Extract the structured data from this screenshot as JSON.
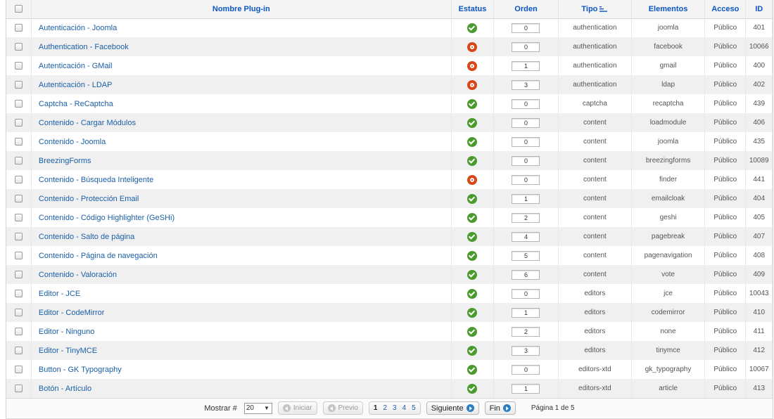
{
  "headers": {
    "name": "Nombre Plug-in",
    "status": "Estatus",
    "order": "Orden",
    "type": "Tipo",
    "elements": "Elementos",
    "access": "Acceso",
    "id": "ID"
  },
  "rows": [
    {
      "name": "Autenticación - Joomla",
      "status": "enabled",
      "order": "0",
      "type": "authentication",
      "element": "joomla",
      "access": "Público",
      "id": "401"
    },
    {
      "name": "Authentication - Facebook",
      "status": "disabled",
      "order": "0",
      "type": "authentication",
      "element": "facebook",
      "access": "Público",
      "id": "10066"
    },
    {
      "name": "Autenticación - GMail",
      "status": "disabled",
      "order": "1",
      "type": "authentication",
      "element": "gmail",
      "access": "Público",
      "id": "400"
    },
    {
      "name": "Autenticación - LDAP",
      "status": "disabled",
      "order": "3",
      "type": "authentication",
      "element": "ldap",
      "access": "Público",
      "id": "402"
    },
    {
      "name": "Captcha - ReCaptcha",
      "status": "enabled",
      "order": "0",
      "type": "captcha",
      "element": "recaptcha",
      "access": "Público",
      "id": "439"
    },
    {
      "name": "Contenido - Cargar Módulos",
      "status": "enabled",
      "order": "0",
      "type": "content",
      "element": "loadmodule",
      "access": "Público",
      "id": "406"
    },
    {
      "name": "Contenido - Joomla",
      "status": "enabled",
      "order": "0",
      "type": "content",
      "element": "joomla",
      "access": "Público",
      "id": "435"
    },
    {
      "name": "BreezingForms",
      "status": "enabled",
      "order": "0",
      "type": "content",
      "element": "breezingforms",
      "access": "Público",
      "id": "10089"
    },
    {
      "name": "Contenido - Búsqueda Inteligente",
      "status": "disabled",
      "order": "0",
      "type": "content",
      "element": "finder",
      "access": "Público",
      "id": "441"
    },
    {
      "name": "Contenido - Protección Email",
      "status": "enabled",
      "order": "1",
      "type": "content",
      "element": "emailcloak",
      "access": "Público",
      "id": "404"
    },
    {
      "name": "Contenido - Código Highlighter (GeSHi)",
      "status": "enabled",
      "order": "2",
      "type": "content",
      "element": "geshi",
      "access": "Público",
      "id": "405"
    },
    {
      "name": "Contenido - Salto de página",
      "status": "enabled",
      "order": "4",
      "type": "content",
      "element": "pagebreak",
      "access": "Público",
      "id": "407"
    },
    {
      "name": "Contenido - Página de navegación",
      "status": "enabled",
      "order": "5",
      "type": "content",
      "element": "pagenavigation",
      "access": "Público",
      "id": "408"
    },
    {
      "name": "Contenido - Valoración",
      "status": "enabled",
      "order": "6",
      "type": "content",
      "element": "vote",
      "access": "Público",
      "id": "409"
    },
    {
      "name": "Editor - JCE",
      "status": "enabled",
      "order": "0",
      "type": "editors",
      "element": "jce",
      "access": "Público",
      "id": "10043"
    },
    {
      "name": "Editor - CodeMirror",
      "status": "enabled",
      "order": "1",
      "type": "editors",
      "element": "codemirror",
      "access": "Público",
      "id": "410"
    },
    {
      "name": "Editor - Ninguno",
      "status": "enabled",
      "order": "2",
      "type": "editors",
      "element": "none",
      "access": "Público",
      "id": "411"
    },
    {
      "name": "Editor - TinyMCE",
      "status": "enabled",
      "order": "3",
      "type": "editors",
      "element": "tinymce",
      "access": "Público",
      "id": "412"
    },
    {
      "name": "Button - GK Typography",
      "status": "enabled",
      "order": "0",
      "type": "editors-xtd",
      "element": "gk_typography",
      "access": "Público",
      "id": "10067"
    },
    {
      "name": "Botón - Artículo",
      "status": "enabled",
      "order": "1",
      "type": "editors-xtd",
      "element": "article",
      "access": "Público",
      "id": "413"
    }
  ],
  "footer": {
    "show_label": "Mostrar #",
    "show_value": "20",
    "start": "Iniciar",
    "prev": "Previo",
    "pages": [
      "1",
      "2",
      "3",
      "4",
      "5"
    ],
    "current_page": "1",
    "next": "Siguiente",
    "end": "Fin",
    "page_info": "Página 1 de 5"
  },
  "colors": {
    "header_text": "#0b55c4",
    "link": "#1a5fa8",
    "enabled": "#4a9a2e",
    "disabled": "#d9461a"
  },
  "icons": {
    "enabled": "check-circle-icon",
    "disabled": "disabled-circle-icon",
    "sort": "sort-asc-icon"
  }
}
